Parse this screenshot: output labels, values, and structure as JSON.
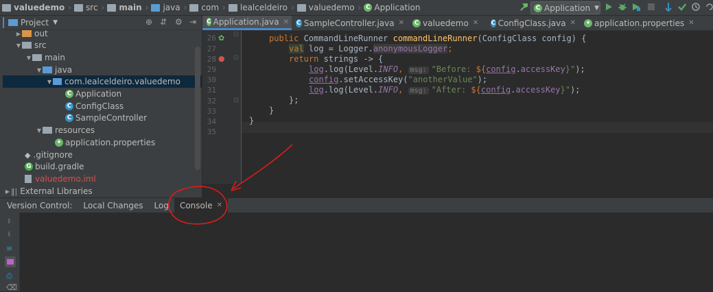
{
  "navbar": {
    "crumbs": [
      "valuedemo",
      "src",
      "main",
      "java",
      "com",
      "lealceldeiro",
      "valuedemo",
      "Application"
    ],
    "run_config": "Application"
  },
  "project": {
    "title": "Project",
    "items": [
      {
        "label": "out",
        "type": "folder-orange"
      },
      {
        "label": "src",
        "type": "folder"
      },
      {
        "label": "main",
        "type": "folder"
      },
      {
        "label": "java",
        "type": "src"
      },
      {
        "label": "com.lealceldeiro.valuedemo",
        "type": "package"
      },
      {
        "label": "Application",
        "type": "spring-class"
      },
      {
        "label": "ConfigClass",
        "type": "class"
      },
      {
        "label": "SampleController",
        "type": "class"
      },
      {
        "label": "resources",
        "type": "res"
      },
      {
        "label": "application.properties",
        "type": "props"
      },
      {
        "label": ".gitignore",
        "type": "file"
      },
      {
        "label": "build.gradle",
        "type": "gradle"
      },
      {
        "label": "valuedemo.iml",
        "type": "iml"
      },
      {
        "label": "External Libraries",
        "type": "libs"
      }
    ]
  },
  "tabs": [
    {
      "label": "Application.java",
      "active": true
    },
    {
      "label": "SampleController.java",
      "active": false
    },
    {
      "label": "valuedemo",
      "active": false
    },
    {
      "label": "ConfigClass.java",
      "active": false
    },
    {
      "label": "application.properties",
      "active": false
    }
  ],
  "editor": {
    "line_numbers": [
      "26",
      "27",
      "28",
      "29",
      "30",
      "31",
      "32",
      "33",
      "34",
      "35"
    ],
    "code": {
      "l26_kw": "public",
      "l26_type": " CommandLineRunner ",
      "l26_fn": "commandLineRunner",
      "l26_rest": "(ConfigClass config) {",
      "l27_kw": "val",
      "l27_rest": " log = Logger.",
      "l27_fld": "anonymousLogger",
      "l27_semi": ";",
      "l28_kw": "return",
      "l28_rest": " strings -> {",
      "l29_a": "log",
      "l29_b": ".log(Level.",
      "l29_c": "INFO",
      "l29_d": ", ",
      "l29_hint": "msg:",
      "l29_str1": "\"Before: ",
      "l29_tmpl1": "${",
      "l29_cfg": "config",
      "l29_dot": ".",
      "l29_key": "accessKey",
      "l29_tmpl2": "}\"",
      "l29_end": ");",
      "l30_a": "config",
      "l30_b": ".setAccessKey(",
      "l30_str": "\"anotherValue\"",
      "l30_end": ");",
      "l31_a": "log",
      "l31_b": ".log(Level.",
      "l31_c": "INFO",
      "l31_d": ", ",
      "l31_hint": "msg:",
      "l31_str1": "\"After: ",
      "l31_tmpl1": "${",
      "l31_cfg": "config",
      "l31_dot": ".",
      "l31_key": "accessKey",
      "l31_tmpl2": "}\"",
      "l31_end": ");",
      "l32": "};",
      "l33": "}",
      "l34": "}"
    }
  },
  "bottom_tabs": {
    "version_control": "Version Control:",
    "local_changes": "Local Changes",
    "log": "Log",
    "console": "Console"
  },
  "colors": {
    "accent": "#4a88c7",
    "annotation": "#e01b1b"
  }
}
